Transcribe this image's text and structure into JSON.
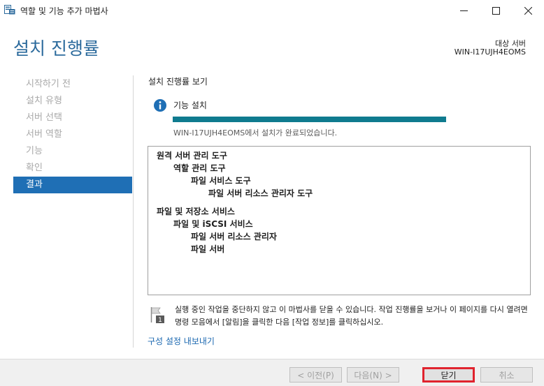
{
  "window": {
    "title": "역할 및 기능 추가 마법사"
  },
  "header": {
    "title": "설치 진행률",
    "destination_label": "대상 서버",
    "destination_value": "WIN-I17UJH4EOMS"
  },
  "sidebar": {
    "items": [
      {
        "label": "시작하기 전",
        "active": false
      },
      {
        "label": "설치 유형",
        "active": false
      },
      {
        "label": "서버 선택",
        "active": false
      },
      {
        "label": "서버 역할",
        "active": false
      },
      {
        "label": "기능",
        "active": false
      },
      {
        "label": "확인",
        "active": false
      },
      {
        "label": "결과",
        "active": true
      }
    ]
  },
  "main": {
    "section_title": "설치 진행률 보기",
    "feature_label": "기능 설치",
    "progress_fraction": 1.0,
    "status": "WIN-I17UJH4EOMS에서 설치가 완료되었습니다.",
    "results": [
      {
        "level": 0,
        "text": "원격 서버 관리 도구"
      },
      {
        "level": 1,
        "text": "역할 관리 도구"
      },
      {
        "level": 2,
        "text": "파일 서비스 도구"
      },
      {
        "level": 3,
        "text": "파일 서버 리소스 관리자 도구"
      },
      {
        "level": 0,
        "text": "파일 및 저장소 서비스",
        "gap_before": true
      },
      {
        "level": 1,
        "text": "파일 및 iSCSI 서비스"
      },
      {
        "level": 2,
        "text": "파일 서버 리소스 관리자"
      },
      {
        "level": 2,
        "text": "파일 서버"
      }
    ],
    "note": "실행 중인 작업을 중단하지 않고 이 마법사를 닫을 수 있습니다. 작업 진행률을 보거나 이 페이지를 다시 열려면 명령 모음에서 [알림]을 클릭한 다음 [작업 정보]를 클릭하십시오.",
    "export_link": "구성 설정 내보내기"
  },
  "footer": {
    "prev_label": "< 이전(P)",
    "next_label": "다음(N) >",
    "close_label": "닫기",
    "cancel_label": "취소"
  },
  "colors": {
    "title_blue": "#2b6a9c",
    "active_nav": "#1f6fb5",
    "progress": "#0f7b8f",
    "link": "#1a67b0",
    "highlight_red": "#e0232e"
  },
  "icons": {
    "app": "server-manager-icon",
    "info": "info-icon",
    "note": "flag-note-icon"
  }
}
